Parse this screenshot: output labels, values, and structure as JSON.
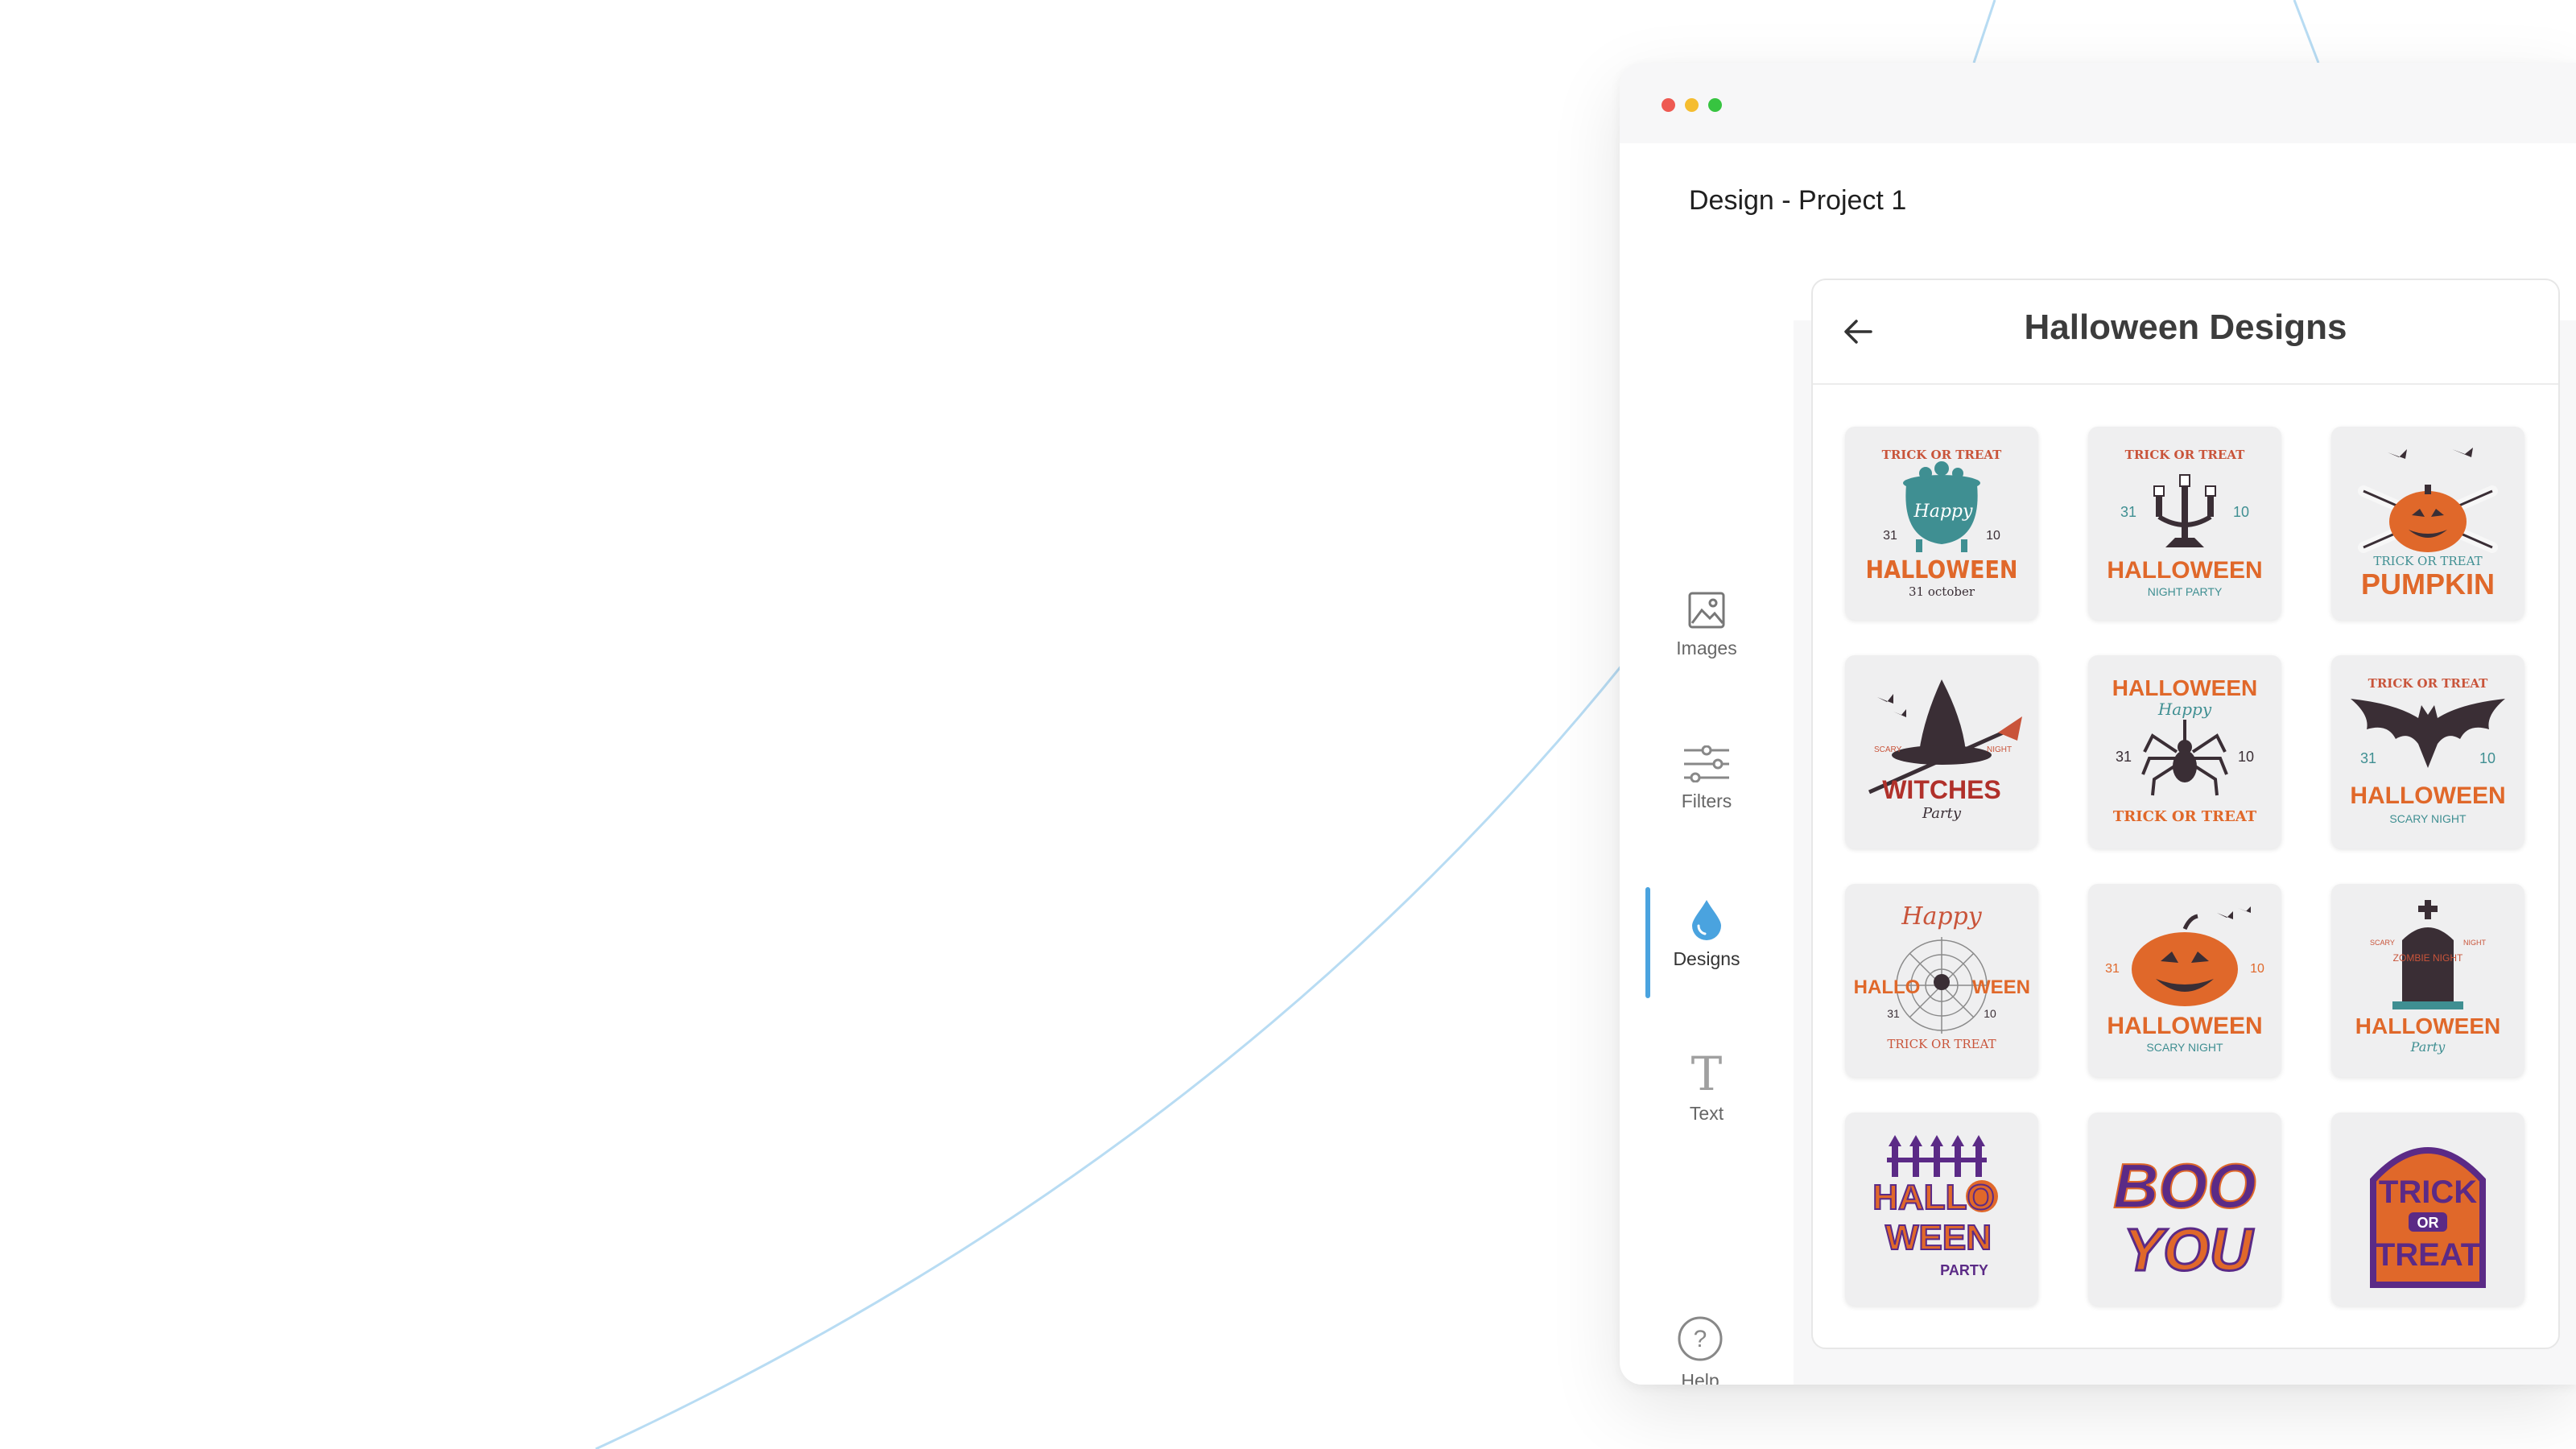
{
  "window": {
    "title": "Design - Project 1",
    "controls": [
      {
        "name": "close",
        "color": "#ee5a52"
      },
      {
        "name": "minimize",
        "color": "#f5bd30"
      },
      {
        "name": "maximize",
        "color": "#37c440"
      }
    ]
  },
  "sidebar": {
    "items": [
      {
        "id": "images",
        "label": "Images",
        "icon": "image-icon",
        "active": false
      },
      {
        "id": "filters",
        "label": "Filters",
        "icon": "sliders-icon",
        "active": false
      },
      {
        "id": "designs",
        "label": "Designs",
        "icon": "drop-icon",
        "active": true
      },
      {
        "id": "text",
        "label": "Text",
        "icon": "text-icon",
        "active": false
      }
    ],
    "help": {
      "label": "Help",
      "icon": "help-icon"
    }
  },
  "panel": {
    "title": "Halloween Designs",
    "back_icon": "arrow-left-icon",
    "designs": [
      {
        "top": "TRICK OR TREAT",
        "script": "Happy",
        "left_num": "31",
        "right_num": "10",
        "main": "HALLOWEEN",
        "sub": "31 october",
        "motif": "cauldron"
      },
      {
        "top": "TRICK OR TREAT",
        "left_num": "31",
        "right_num": "10",
        "main": "HALLOWEEN",
        "sub": "NIGHT PARTY",
        "motif": "candelabra"
      },
      {
        "mid": "TRICK OR TREAT",
        "main": "PUMPKIN",
        "motif": "pumpkin-crossbones"
      },
      {
        "left_small": "SCARY",
        "right_small": "NIGHT",
        "main": "WITCHES",
        "script": "Party",
        "motif": "witch-hat"
      },
      {
        "top": "HALLOWEEN",
        "script": "Happy",
        "left_num": "31",
        "right_num": "10",
        "bottom": "TRICK OR TREAT",
        "motif": "spider"
      },
      {
        "top": "TRICK OR TREAT",
        "left_num": "31",
        "right_num": "10",
        "main": "HALLOWEEN",
        "sub": "SCARY NIGHT",
        "motif": "bat"
      },
      {
        "script": "Happy",
        "main_left": "HALLO",
        "main_right": "WEEN",
        "left_num": "31",
        "right_num": "10",
        "bottom": "TRICK OR TREAT",
        "motif": "spider-web"
      },
      {
        "left_num": "31",
        "right_num": "10",
        "main": "HALLOWEEN",
        "sub": "SCARY NIGHT",
        "motif": "jack-o-lantern"
      },
      {
        "left_small": "SCARY",
        "right_small": "NIGHT",
        "stone": "ZOMBIE NIGHT",
        "main": "HALLOWEEN",
        "script": "Party",
        "motif": "tombstone"
      },
      {
        "line1": "HALLO",
        "line2": "WEEN",
        "sub": "PARTY",
        "motif": "fence"
      },
      {
        "line1": "BOO",
        "line2": "YOU",
        "motif": "boo"
      },
      {
        "line1": "TRICK",
        "mid": "OR",
        "line2": "TREAT",
        "motif": "gravestone"
      }
    ]
  },
  "colors": {
    "accent": "#4aa3df",
    "orange": "#e0682a",
    "teal": "#3f8f92",
    "dark": "#3a2e35",
    "purple": "#5b2a86",
    "red": "#c73a2c"
  }
}
